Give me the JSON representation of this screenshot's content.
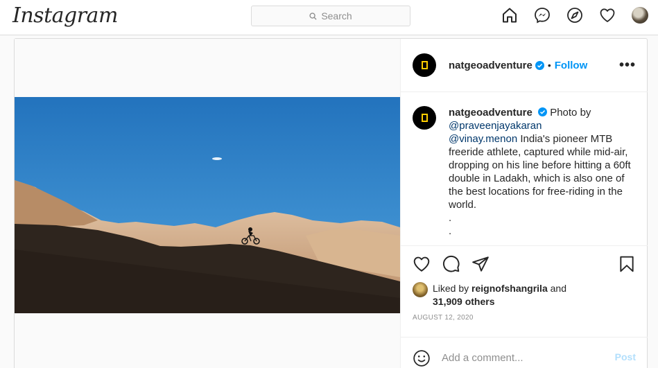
{
  "header": {
    "logo": "Instagram",
    "search_placeholder": "Search",
    "nav_icons": [
      "home-icon",
      "messenger-icon",
      "explore-icon",
      "heart-icon",
      "profile-avatar"
    ]
  },
  "post": {
    "username": "natgeoadventure",
    "follow_label": "Follow",
    "separator": "•",
    "more_label": "•••",
    "caption": {
      "username": "natgeoadventure",
      "intro": "Photo by",
      "mention1": "@praveenjayakaran",
      "mention2": "@vinay.menon",
      "body": "India's pioneer MTB freeride athlete, captured while mid-air, dropping on his line before hitting a 60ft double in Ladakh, which is also one of the best locations for free-riding in the world.",
      "trail1": ".",
      "trail2": "."
    },
    "likes": {
      "prefix": "Liked by",
      "liker": "reignofshangrila",
      "joiner": "and",
      "others": "31,909 others"
    },
    "date": "AUGUST 12, 2020",
    "comment_placeholder": "Add a comment...",
    "post_label": "Post"
  },
  "colors": {
    "link": "#0095f6",
    "mention": "#00376b",
    "post_disabled": "#b2dffc",
    "sky": "#2f7fc4",
    "brand_frame": "#ffce00"
  }
}
